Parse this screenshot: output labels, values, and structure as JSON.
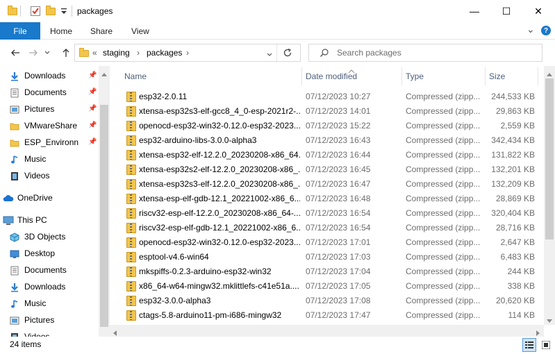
{
  "window": {
    "title": "packages",
    "controls": {
      "minimize": "—",
      "maximize": "☐",
      "close": "✕"
    }
  },
  "ribbon": {
    "file": "File",
    "tabs": [
      "Home",
      "Share",
      "View"
    ],
    "expand_glyph": "⌄",
    "help_glyph": "?"
  },
  "address": {
    "overflow": "«",
    "crumbs": [
      "staging",
      "packages"
    ],
    "sep": "›",
    "search_placeholder": "Search packages"
  },
  "sidebar": {
    "items": [
      {
        "label": "Downloads",
        "icon": "download-arrow-icon",
        "pinned": true
      },
      {
        "label": "Documents",
        "icon": "documents-icon",
        "pinned": true
      },
      {
        "label": "Pictures",
        "icon": "pictures-icon",
        "pinned": true
      },
      {
        "label": "VMwareShare",
        "icon": "folder-icon",
        "pinned": true
      },
      {
        "label": "ESP_Environn",
        "icon": "folder-icon",
        "pinned": true
      },
      {
        "label": "Music",
        "icon": "music-icon",
        "pinned": false
      },
      {
        "label": "Videos",
        "icon": "videos-icon",
        "pinned": false
      },
      {
        "label": "OneDrive",
        "icon": "cloud-icon",
        "pinned": false
      },
      {
        "label": "This PC",
        "icon": "computer-icon",
        "pinned": false
      },
      {
        "label": "3D Objects",
        "icon": "cube-icon",
        "pinned": false
      },
      {
        "label": "Desktop",
        "icon": "desktop-icon",
        "pinned": false
      },
      {
        "label": "Documents",
        "icon": "documents-icon",
        "pinned": false
      },
      {
        "label": "Downloads",
        "icon": "download-arrow-icon",
        "pinned": false
      },
      {
        "label": "Music",
        "icon": "music-icon",
        "pinned": false
      },
      {
        "label": "Pictures",
        "icon": "pictures-icon",
        "pinned": false
      },
      {
        "label": "Videos",
        "icon": "videos-icon",
        "pinned": false
      }
    ],
    "pin_glyph": "📌"
  },
  "columns": {
    "name": "Name",
    "date": "Date modified",
    "type": "Type",
    "size": "Size"
  },
  "files": [
    {
      "name": "esp32-2.0.11",
      "date": "07/12/2023 10:27",
      "type": "Compressed (zipp...",
      "size": "244,533 KB"
    },
    {
      "name": "xtensa-esp32s3-elf-gcc8_4_0-esp-2021r2-...",
      "date": "07/12/2023 14:01",
      "type": "Compressed (zipp...",
      "size": "29,863 KB"
    },
    {
      "name": "openocd-esp32-win32-0.12.0-esp32-2023...",
      "date": "07/12/2023 15:22",
      "type": "Compressed (zipp...",
      "size": "2,559 KB"
    },
    {
      "name": "esp32-arduino-libs-3.0.0-alpha3",
      "date": "07/12/2023 16:43",
      "type": "Compressed (zipp...",
      "size": "342,434 KB"
    },
    {
      "name": "xtensa-esp32-elf-12.2.0_20230208-x86_64...",
      "date": "07/12/2023 16:44",
      "type": "Compressed (zipp...",
      "size": "131,822 KB"
    },
    {
      "name": "xtensa-esp32s2-elf-12.2.0_20230208-x86_...",
      "date": "07/12/2023 16:45",
      "type": "Compressed (zipp...",
      "size": "132,201 KB"
    },
    {
      "name": "xtensa-esp32s3-elf-12.2.0_20230208-x86_...",
      "date": "07/12/2023 16:47",
      "type": "Compressed (zipp...",
      "size": "132,209 KB"
    },
    {
      "name": "xtensa-esp-elf-gdb-12.1_20221002-x86_6...",
      "date": "07/12/2023 16:48",
      "type": "Compressed (zipp...",
      "size": "28,869 KB"
    },
    {
      "name": "riscv32-esp-elf-12.2.0_20230208-x86_64-...",
      "date": "07/12/2023 16:54",
      "type": "Compressed (zipp...",
      "size": "320,404 KB"
    },
    {
      "name": "riscv32-esp-elf-gdb-12.1_20221002-x86_6...",
      "date": "07/12/2023 16:54",
      "type": "Compressed (zipp...",
      "size": "28,716 KB"
    },
    {
      "name": "openocd-esp32-win32-0.12.0-esp32-2023...",
      "date": "07/12/2023 17:01",
      "type": "Compressed (zipp...",
      "size": "2,647 KB"
    },
    {
      "name": "esptool-v4.6-win64",
      "date": "07/12/2023 17:03",
      "type": "Compressed (zipp...",
      "size": "6,483 KB"
    },
    {
      "name": "mkspiffs-0.2.3-arduino-esp32-win32",
      "date": "07/12/2023 17:04",
      "type": "Compressed (zipp...",
      "size": "244 KB"
    },
    {
      "name": "x86_64-w64-mingw32.mklittlefs-c41e51a....",
      "date": "07/12/2023 17:05",
      "type": "Compressed (zipp...",
      "size": "338 KB"
    },
    {
      "name": "esp32-3.0.0-alpha3",
      "date": "07/12/2023 17:08",
      "type": "Compressed (zipp...",
      "size": "20,620 KB"
    },
    {
      "name": "ctags-5.8-arduino11-pm-i686-mingw32",
      "date": "07/12/2023 17:47",
      "type": "Compressed (zipp...",
      "size": "114 KB"
    }
  ],
  "status": {
    "count": "24 items"
  }
}
